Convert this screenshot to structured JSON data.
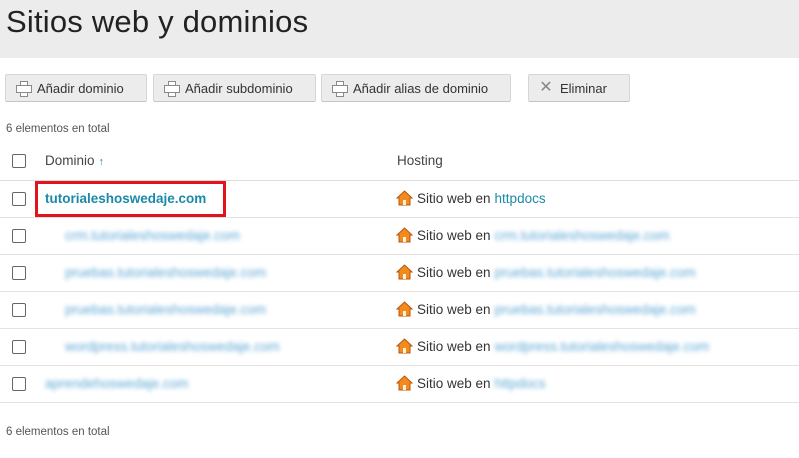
{
  "page": {
    "title": "Sitios web y dominios"
  },
  "toolbar": {
    "add_domain": "Añadir dominio",
    "add_subdomain": "Añadir subdominio",
    "add_alias": "Añadir alias de dominio",
    "remove": "Eliminar"
  },
  "summary": {
    "top": "6 elementos en total",
    "bottom": "6 elementos en total"
  },
  "table": {
    "col_domain": "Dominio",
    "col_hosting": "Hosting",
    "sort_indicator": "↑",
    "rows": [
      {
        "domain": "tutorialeshoswedaje.com",
        "hosting_prefix": "Sitio web en",
        "hosting_link": "httpdocs"
      },
      {
        "domain": "crm.tutorialeshoswedaje.com",
        "hosting_prefix": "Sitio web en",
        "hosting_link": "crm.tutorialeshoswedaje.com"
      },
      {
        "domain": "pruebas.tutorialeshoswedaje.com",
        "hosting_prefix": "Sitio web en",
        "hosting_link": "pruebas.tutorialeshoswedaje.com"
      },
      {
        "domain": "pruebas.tutorialeshoswedaje.com",
        "hosting_prefix": "Sitio web en",
        "hosting_link": "pruebas.tutorialeshoswedaje.com"
      },
      {
        "domain": "wordpress.tutorialeshoswedaje.com",
        "hosting_prefix": "Sitio web en",
        "hosting_link": "wordpress.tutorialeshoswedaje.com"
      },
      {
        "domain": "aprendehoswedaje.com",
        "hosting_prefix": "Sitio web en",
        "hosting_link": "httpdocs"
      }
    ]
  },
  "colors": {
    "link": "#1a8aa8",
    "highlight": "#e3131e",
    "header_bg": "#ececec"
  },
  "icons": {
    "add": "plus-icon",
    "remove": "x-icon",
    "hosting": "house-icon"
  }
}
